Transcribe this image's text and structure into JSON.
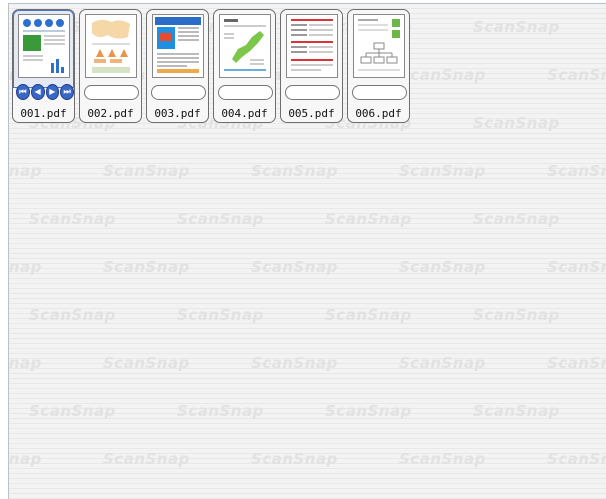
{
  "watermark": "ScanSnap",
  "files": [
    {
      "name": "001.pdf",
      "thumb": "doc-blue-circles"
    },
    {
      "name": "002.pdf",
      "thumb": "doc-map-orange"
    },
    {
      "name": "003.pdf",
      "thumb": "doc-brochure"
    },
    {
      "name": "004.pdf",
      "thumb": "doc-green-map"
    },
    {
      "name": "005.pdf",
      "thumb": "doc-red-form"
    },
    {
      "name": "006.pdf",
      "thumb": "doc-diagram"
    }
  ],
  "nav_icons": [
    "first-page-icon",
    "prev-page-icon",
    "next-page-icon",
    "last-page-icon"
  ],
  "nav_glyphs": [
    "⏮",
    "◀",
    "▶",
    "⏭"
  ],
  "colors": {
    "nav_blue": "#3a66c4",
    "watermark": "#e2e2e2"
  }
}
